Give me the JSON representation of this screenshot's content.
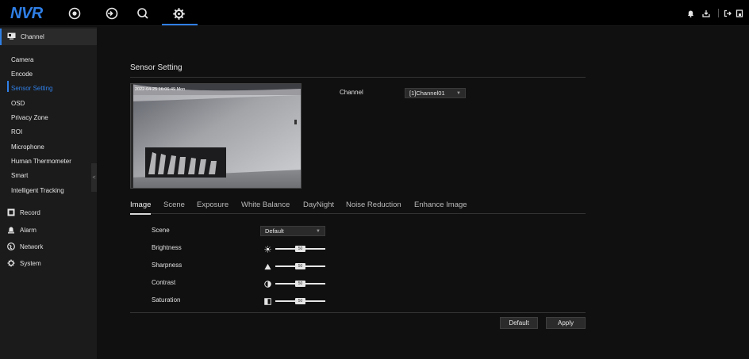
{
  "app": {
    "logo": "NVR"
  },
  "topnav": {
    "items": [
      {
        "name": "live-view",
        "icon": "target-icon"
      },
      {
        "name": "playback",
        "icon": "playback-icon"
      },
      {
        "name": "search",
        "icon": "search-icon"
      },
      {
        "name": "settings",
        "icon": "gear-icon",
        "active": true
      }
    ],
    "right_icons": [
      "bell-icon",
      "download-icon",
      "logout-icon",
      "lock-icon"
    ]
  },
  "sidebar": {
    "headers": [
      {
        "label": "Channel",
        "icon": "monitor-icon",
        "active": true
      },
      {
        "label": "Record",
        "icon": "record-icon"
      },
      {
        "label": "Alarm",
        "icon": "alarm-icon"
      },
      {
        "label": "Network",
        "icon": "globe-icon"
      },
      {
        "label": "System",
        "icon": "cog-icon"
      }
    ],
    "channel_items": [
      "Camera",
      "Encode",
      "Sensor Setting",
      "OSD",
      "Privacy Zone",
      "ROI",
      "Microphone",
      "Human Thermometer",
      "Smart",
      "Intelligent Tracking"
    ],
    "active_item": "Sensor Setting",
    "collapse_glyph": "<"
  },
  "main": {
    "title": "Sensor Setting",
    "preview": {
      "osd_timestamp": "2022-04-25 16:06:49 Mon"
    },
    "channel": {
      "label": "Channel",
      "value": "[1]Channel01"
    },
    "tabs": [
      "Image",
      "Scene",
      "Exposure",
      "White Balance",
      "DayNight",
      "Noise Reduction",
      "Enhance Image"
    ],
    "active_tab": "Image",
    "settings": {
      "scene": {
        "label": "Scene",
        "value": "Default"
      },
      "brightness": {
        "label": "Brightness",
        "value": 50,
        "icon": "sun-icon"
      },
      "sharpness": {
        "label": "Sharpness",
        "value": 50,
        "icon": "sharpness-icon"
      },
      "contrast": {
        "label": "Contrast",
        "value": 50,
        "icon": "contrast-icon"
      },
      "saturation": {
        "label": "Saturation",
        "value": 50,
        "icon": "saturation-icon"
      }
    },
    "buttons": {
      "default": "Default",
      "apply": "Apply"
    }
  },
  "colors": {
    "accent": "#2f7fe6",
    "background": "#101010",
    "sidebar": "#1b1b1b"
  }
}
